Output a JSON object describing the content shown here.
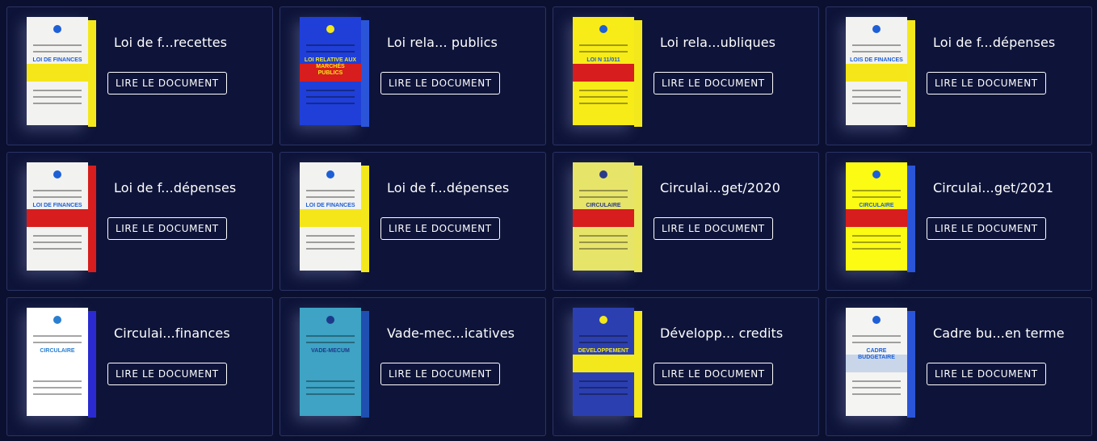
{
  "button_label": "LIRE LE DOCUMENT",
  "documents": [
    {
      "title": "Loi de f...recettes",
      "cover": {
        "bg": "#f2f2f0",
        "accent": "#1d5fd6",
        "band": "#f5e61a",
        "spine": "#f3e81c",
        "heading": "LOI DE FINANCES"
      }
    },
    {
      "title": "Loi rela... publics",
      "cover": {
        "bg": "#1f3fd8",
        "accent": "#f3e81c",
        "band": "#d71d1d",
        "spine": "#2b55d9",
        "heading": "LOI RELATIVE AUX MARCHÉS PUBLICS"
      }
    },
    {
      "title": "Loi rela...ubliques",
      "cover": {
        "bg": "#f7ec17",
        "accent": "#1d5fd6",
        "band": "#d71d1d",
        "spine": "#f3e81c",
        "heading": "LOI N 11/011"
      }
    },
    {
      "title": "Loi de f...dépenses",
      "cover": {
        "bg": "#f2f2f0",
        "accent": "#1d5fd6",
        "band": "#f5e61a",
        "spine": "#f3e81c",
        "heading": "LOIS DE FINANCES"
      }
    },
    {
      "title": "Loi de f...dépenses",
      "cover": {
        "bg": "#f2f2f0",
        "accent": "#1d5fd6",
        "band": "#d71d1d",
        "spine": "#d71d1d",
        "heading": "LOI DE FINANCES"
      }
    },
    {
      "title": "Loi de f...dépenses",
      "cover": {
        "bg": "#f2f2f0",
        "accent": "#1d5fd6",
        "band": "#f5e61a",
        "spine": "#f3e81c",
        "heading": "LOI DE FINANCES"
      }
    },
    {
      "title": "Circulai...get/2020",
      "cover": {
        "bg": "#e7e46a",
        "accent": "#2c3c8a",
        "band": "#d71d1d",
        "spine": "#e9e55c",
        "heading": "CIRCULAIRE"
      }
    },
    {
      "title": "Circulai...get/2021",
      "cover": {
        "bg": "#fbfb14",
        "accent": "#1d5fd6",
        "band": "#d71d1d",
        "spine": "#2b55d9",
        "heading": "CIRCULAIRE"
      }
    },
    {
      "title": "Circulai...finances",
      "cover": {
        "bg": "#ffffff",
        "accent": "#2a7fd0",
        "band": "#ffffff",
        "spine": "#2a2ad0",
        "heading": "CIRCULAIRE"
      }
    },
    {
      "title": "Vade-mec...icatives",
      "cover": {
        "bg": "#3ea3c4",
        "accent": "#1d3a8a",
        "band": "#3ea3c4",
        "spine": "#1f4fb0",
        "heading": "VADE-MECUM"
      }
    },
    {
      "title": "Développ... credits",
      "cover": {
        "bg": "#2c3fb0",
        "accent": "#f3e81c",
        "band": "#f3e81c",
        "spine": "#f3e81c",
        "heading": "DEVELOPPEMENT"
      }
    },
    {
      "title": "Cadre bu...en terme",
      "cover": {
        "bg": "#f4f4f2",
        "accent": "#1d5fd6",
        "band": "#c9d6ea",
        "spine": "#2b55d9",
        "heading": "CADRE BUDGETAIRE"
      }
    }
  ]
}
